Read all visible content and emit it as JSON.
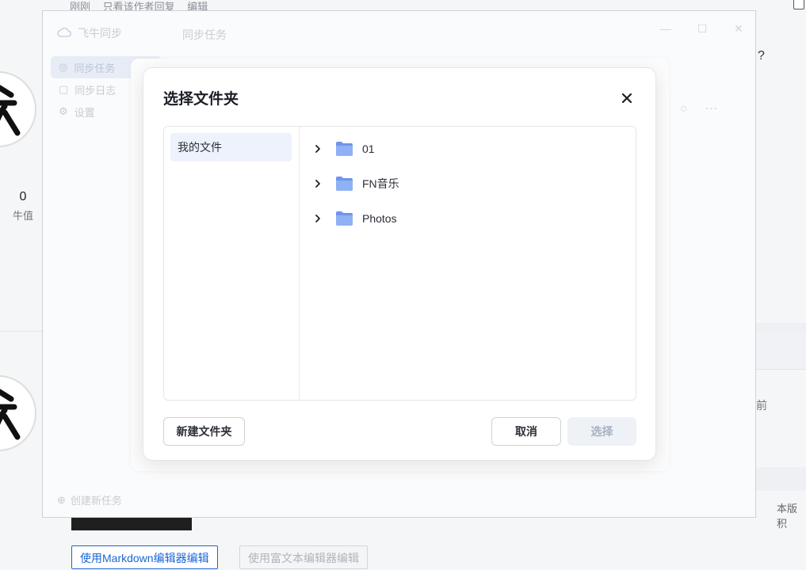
{
  "background": {
    "top_meta": [
      "刚刚",
      "只看该作者回复",
      "编辑"
    ],
    "stat_value": "0",
    "stat_label": "牛值",
    "right_fragment_question": "?",
    "right_fragment_before": "前",
    "right_fragment_version": "本版积",
    "dark_button_label": "",
    "markdown_button": "使用Markdown编辑器编辑",
    "richtext_button": "使用富文本编辑器编辑"
  },
  "app": {
    "brand": "飞牛同步",
    "title": "同步任务",
    "nav": [
      {
        "label": "同步任务",
        "active": true
      },
      {
        "label": "同步日志",
        "active": false
      },
      {
        "label": "设置",
        "active": false
      }
    ],
    "new_task": "创建新任务"
  },
  "dialog": {
    "title": "选择文件夹",
    "sidebar": [
      "我的文件"
    ],
    "folders": [
      "01",
      "FN音乐",
      "Photos"
    ],
    "new_folder_button": "新建文件夹",
    "cancel_button": "取消",
    "select_button": "选择"
  },
  "colors": {
    "folder_blue": "#8fb1f5",
    "folder_blue_dark": "#6f95ea",
    "selected_bg": "#edf2fc",
    "disabled_text": "#a9b2c1"
  }
}
